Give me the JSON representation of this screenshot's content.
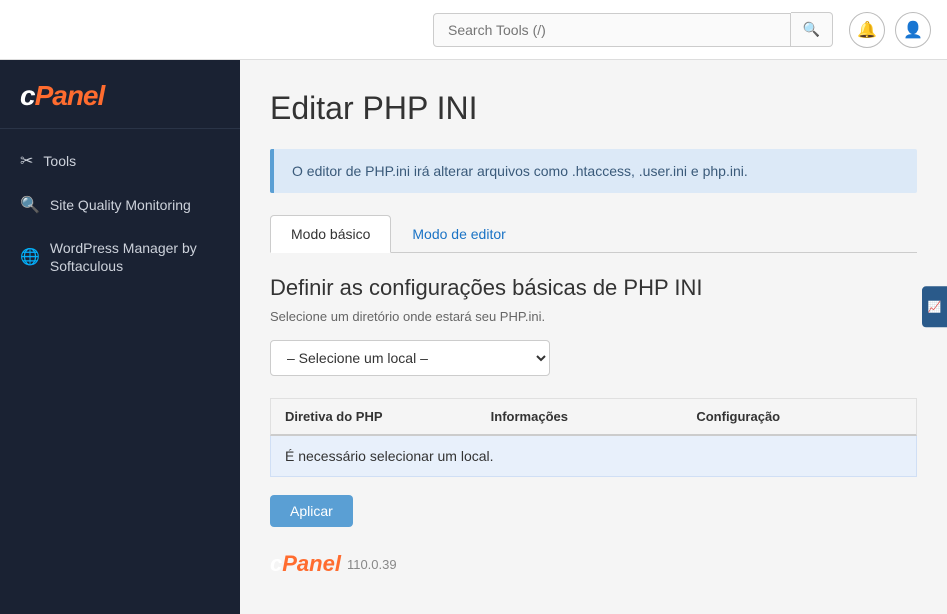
{
  "topbar": {
    "search_placeholder": "Search Tools (/)",
    "search_icon": "🔍",
    "bell_icon": "🔔",
    "user_icon": "👤"
  },
  "sidebar": {
    "logo": "cPanel",
    "items": [
      {
        "id": "tools",
        "label": "Tools",
        "icon": "✂"
      },
      {
        "id": "site-quality-monitoring",
        "label": "Site Quality Monitoring",
        "icon": "🔍"
      },
      {
        "id": "wordpress-manager",
        "label": "WordPress Manager by Softaculous",
        "icon": "🌀"
      }
    ]
  },
  "main": {
    "page_title": "Editar PHP INI",
    "info_message": "O editor de PHP.ini irá alterar arquivos como .htaccess, .user.ini e php.ini.",
    "tabs": [
      {
        "id": "modo-basico",
        "label": "Modo básico",
        "active": true
      },
      {
        "id": "modo-editor",
        "label": "Modo de editor",
        "active": false
      }
    ],
    "section_title": "Definir as configurações básicas de PHP INI",
    "section_subtitle": "Selecione um diretório onde estará seu PHP.ini.",
    "dropdown": {
      "default_option": "– Selecione um local –"
    },
    "table": {
      "columns": [
        "Diretiva do PHP",
        "Informações",
        "Configuração"
      ],
      "message": "É necessário selecionar um local."
    },
    "apply_button": "Aplicar",
    "footer": {
      "logo": "cPanel",
      "version": "110.0.39"
    }
  }
}
